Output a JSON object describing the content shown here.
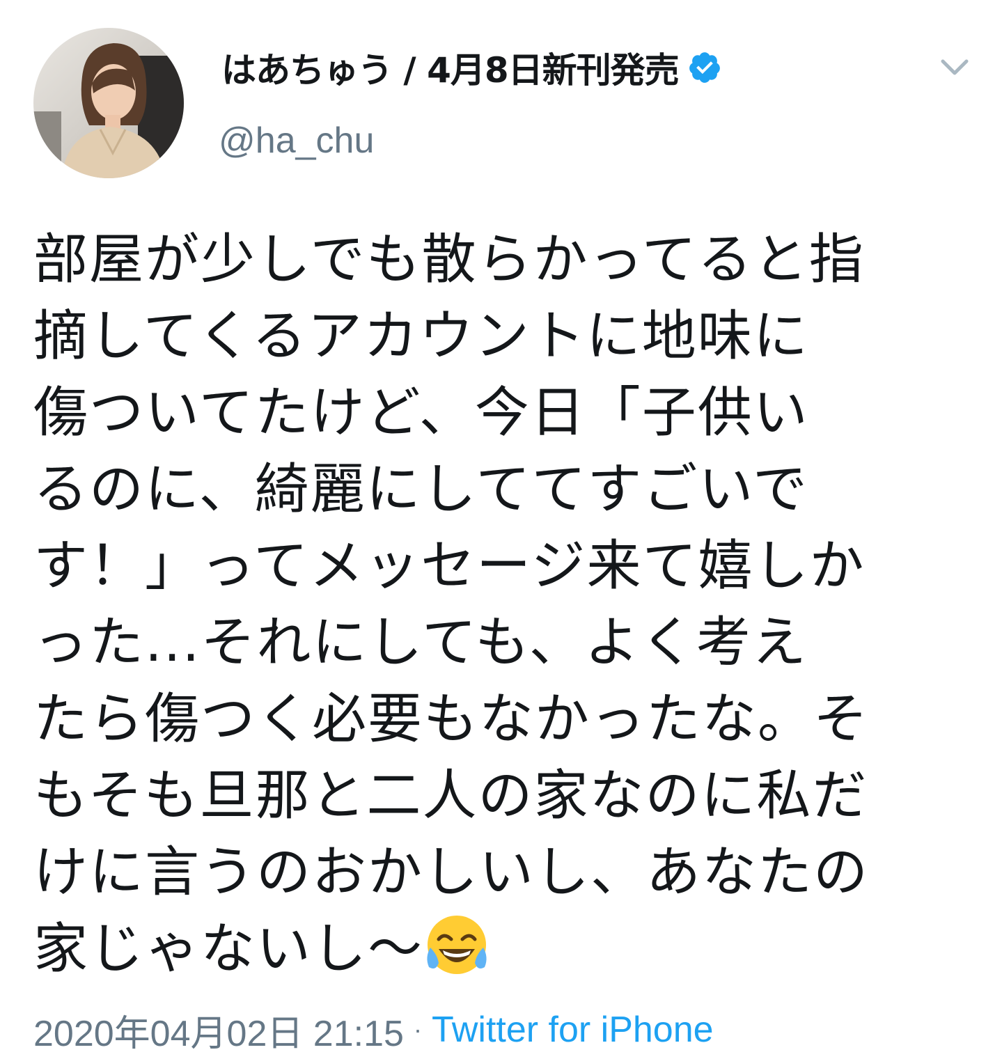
{
  "colors": {
    "verified": "#1da1f2",
    "handle_gray": "#657786",
    "link_blue": "#1da1f2",
    "text": "#14171a"
  },
  "user": {
    "display_name": "はあちゅう / 4月8日新刊発売",
    "handle": "@ha_chu",
    "verified_icon": "verified-badge-icon",
    "avatar_icon": "profile-photo"
  },
  "menu": {
    "icon": "chevron-down-icon"
  },
  "tweet": {
    "lines": [
      "部屋が少しでも散らかってると指",
      "摘してくるアカウントに地味に",
      "傷ついてたけど、今日「子供い",
      "るのに、綺麗にしててすごいで",
      "す！」ってメッセージ来て嬉しか",
      "った...それにしても、よく考え",
      "たら傷つく必要もなかったな。そ",
      "もそも旦那と二人の家なのに私だ",
      "けに言うのおかしいし、あなたの",
      "家じゃないし〜"
    ],
    "emoji": "face-with-tears-of-joy-icon"
  },
  "meta": {
    "timestamp": "2020年04月02日 21:15",
    "separator": "·",
    "source": "Twitter for iPhone"
  }
}
